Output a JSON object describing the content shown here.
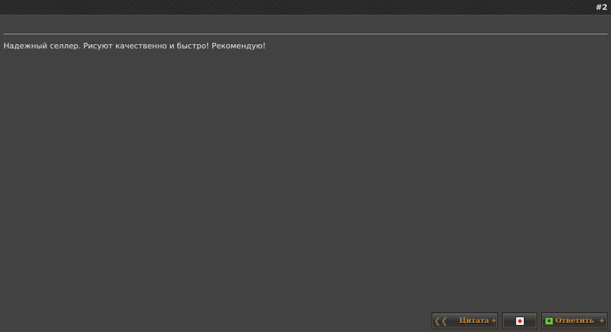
{
  "post": {
    "number": "#2",
    "message": "Надежный селлер. Рисуют качественно и быстро! Рекомендую!"
  },
  "buttons": {
    "quote_label": "Цитата",
    "reply_label": "Ответить"
  },
  "icons": {
    "report": "report-icon",
    "reply": "reply-icon",
    "ornament": "ornament-icon"
  },
  "colors": {
    "background": "#424242",
    "text": "#e8e8e8",
    "button_label": "#d08a3a",
    "header": "#2a2a2a"
  }
}
